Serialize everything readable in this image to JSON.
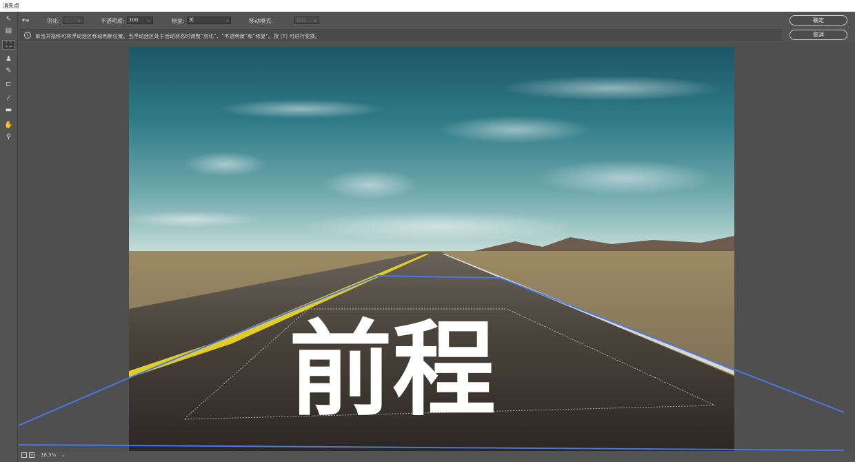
{
  "window": {
    "title": "消失点"
  },
  "options": {
    "menu_icon": "menu-icon",
    "feather_label": "羽化:",
    "feather_value": "",
    "opacity_label": "不透明度:",
    "opacity_value": "100",
    "heal_label": "修复:",
    "heal_value": "关",
    "move_mode_label": "移动模式:",
    "move_mode_value": "目标"
  },
  "info": {
    "icon": "i",
    "text": "单击并拖移可将浮动选区移动到新位置。当浮动选区处于活动状态时调整“羽化”、“不透明度”和“修复”。按 (T) 可进行变换。"
  },
  "buttons": {
    "ok": "确定",
    "cancel": "取消"
  },
  "tools": [
    {
      "name": "edit-plane-tool-icon",
      "glyph": "↖"
    },
    {
      "name": "create-plane-tool-icon",
      "glyph": "▤"
    },
    {
      "name": "marquee-tool-icon",
      "glyph": "⬚"
    },
    {
      "name": "stamp-tool-icon",
      "glyph": "♟"
    },
    {
      "name": "brush-tool-icon",
      "glyph": "✎"
    },
    {
      "name": "transform-tool-icon",
      "glyph": "⊏"
    },
    {
      "name": "eyedropper-tool-icon",
      "glyph": "⁄"
    },
    {
      "name": "measure-tool-icon",
      "glyph": "▬"
    },
    {
      "name": "hand-tool-icon",
      "glyph": "✋"
    },
    {
      "name": "zoom-tool-icon",
      "glyph": "⚲"
    }
  ],
  "canvas": {
    "road_text": "前程"
  },
  "status": {
    "zoom": "18.3%"
  },
  "colors": {
    "grid_line": "#4a78e6",
    "sky_top": "#1f5f70",
    "asphalt": "#3b3630",
    "center_line": "#e1cc2b"
  }
}
